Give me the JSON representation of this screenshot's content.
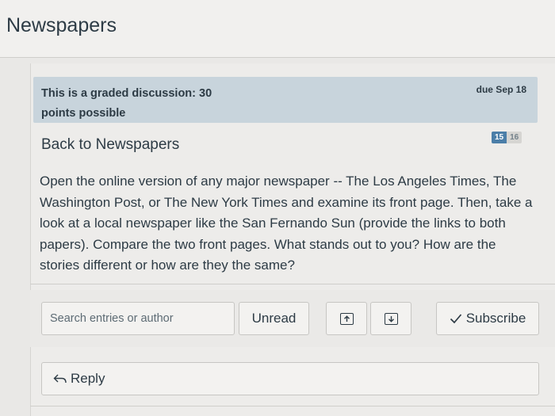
{
  "header": {
    "title": "Newspapers"
  },
  "banner": {
    "graded_text": "This is a graded discussion: 30 points possible",
    "due": "due Sep 18"
  },
  "topic": {
    "back_link": "Back to Newspapers",
    "unread_count": "15",
    "total_count": "16",
    "prompt": "Open the online version of any major newspaper -- The Los Angeles Times, The Washington Post, or The New York Times and examine its front page. Then, take a look at a local newspaper like the San Fernando Sun (provide the links to both papers). Compare the two front pages. What stands out to you? How are the stories different or how are they the same?"
  },
  "toolbar": {
    "search_placeholder": "Search entries or author",
    "unread_label": "Unread",
    "subscribe_label": "Subscribe"
  },
  "reply": {
    "label": "Reply"
  },
  "icons": {
    "collapse": "collapse-up-icon",
    "expand": "expand-down-icon",
    "check": "check-icon",
    "reply": "reply-arrow-icon"
  }
}
